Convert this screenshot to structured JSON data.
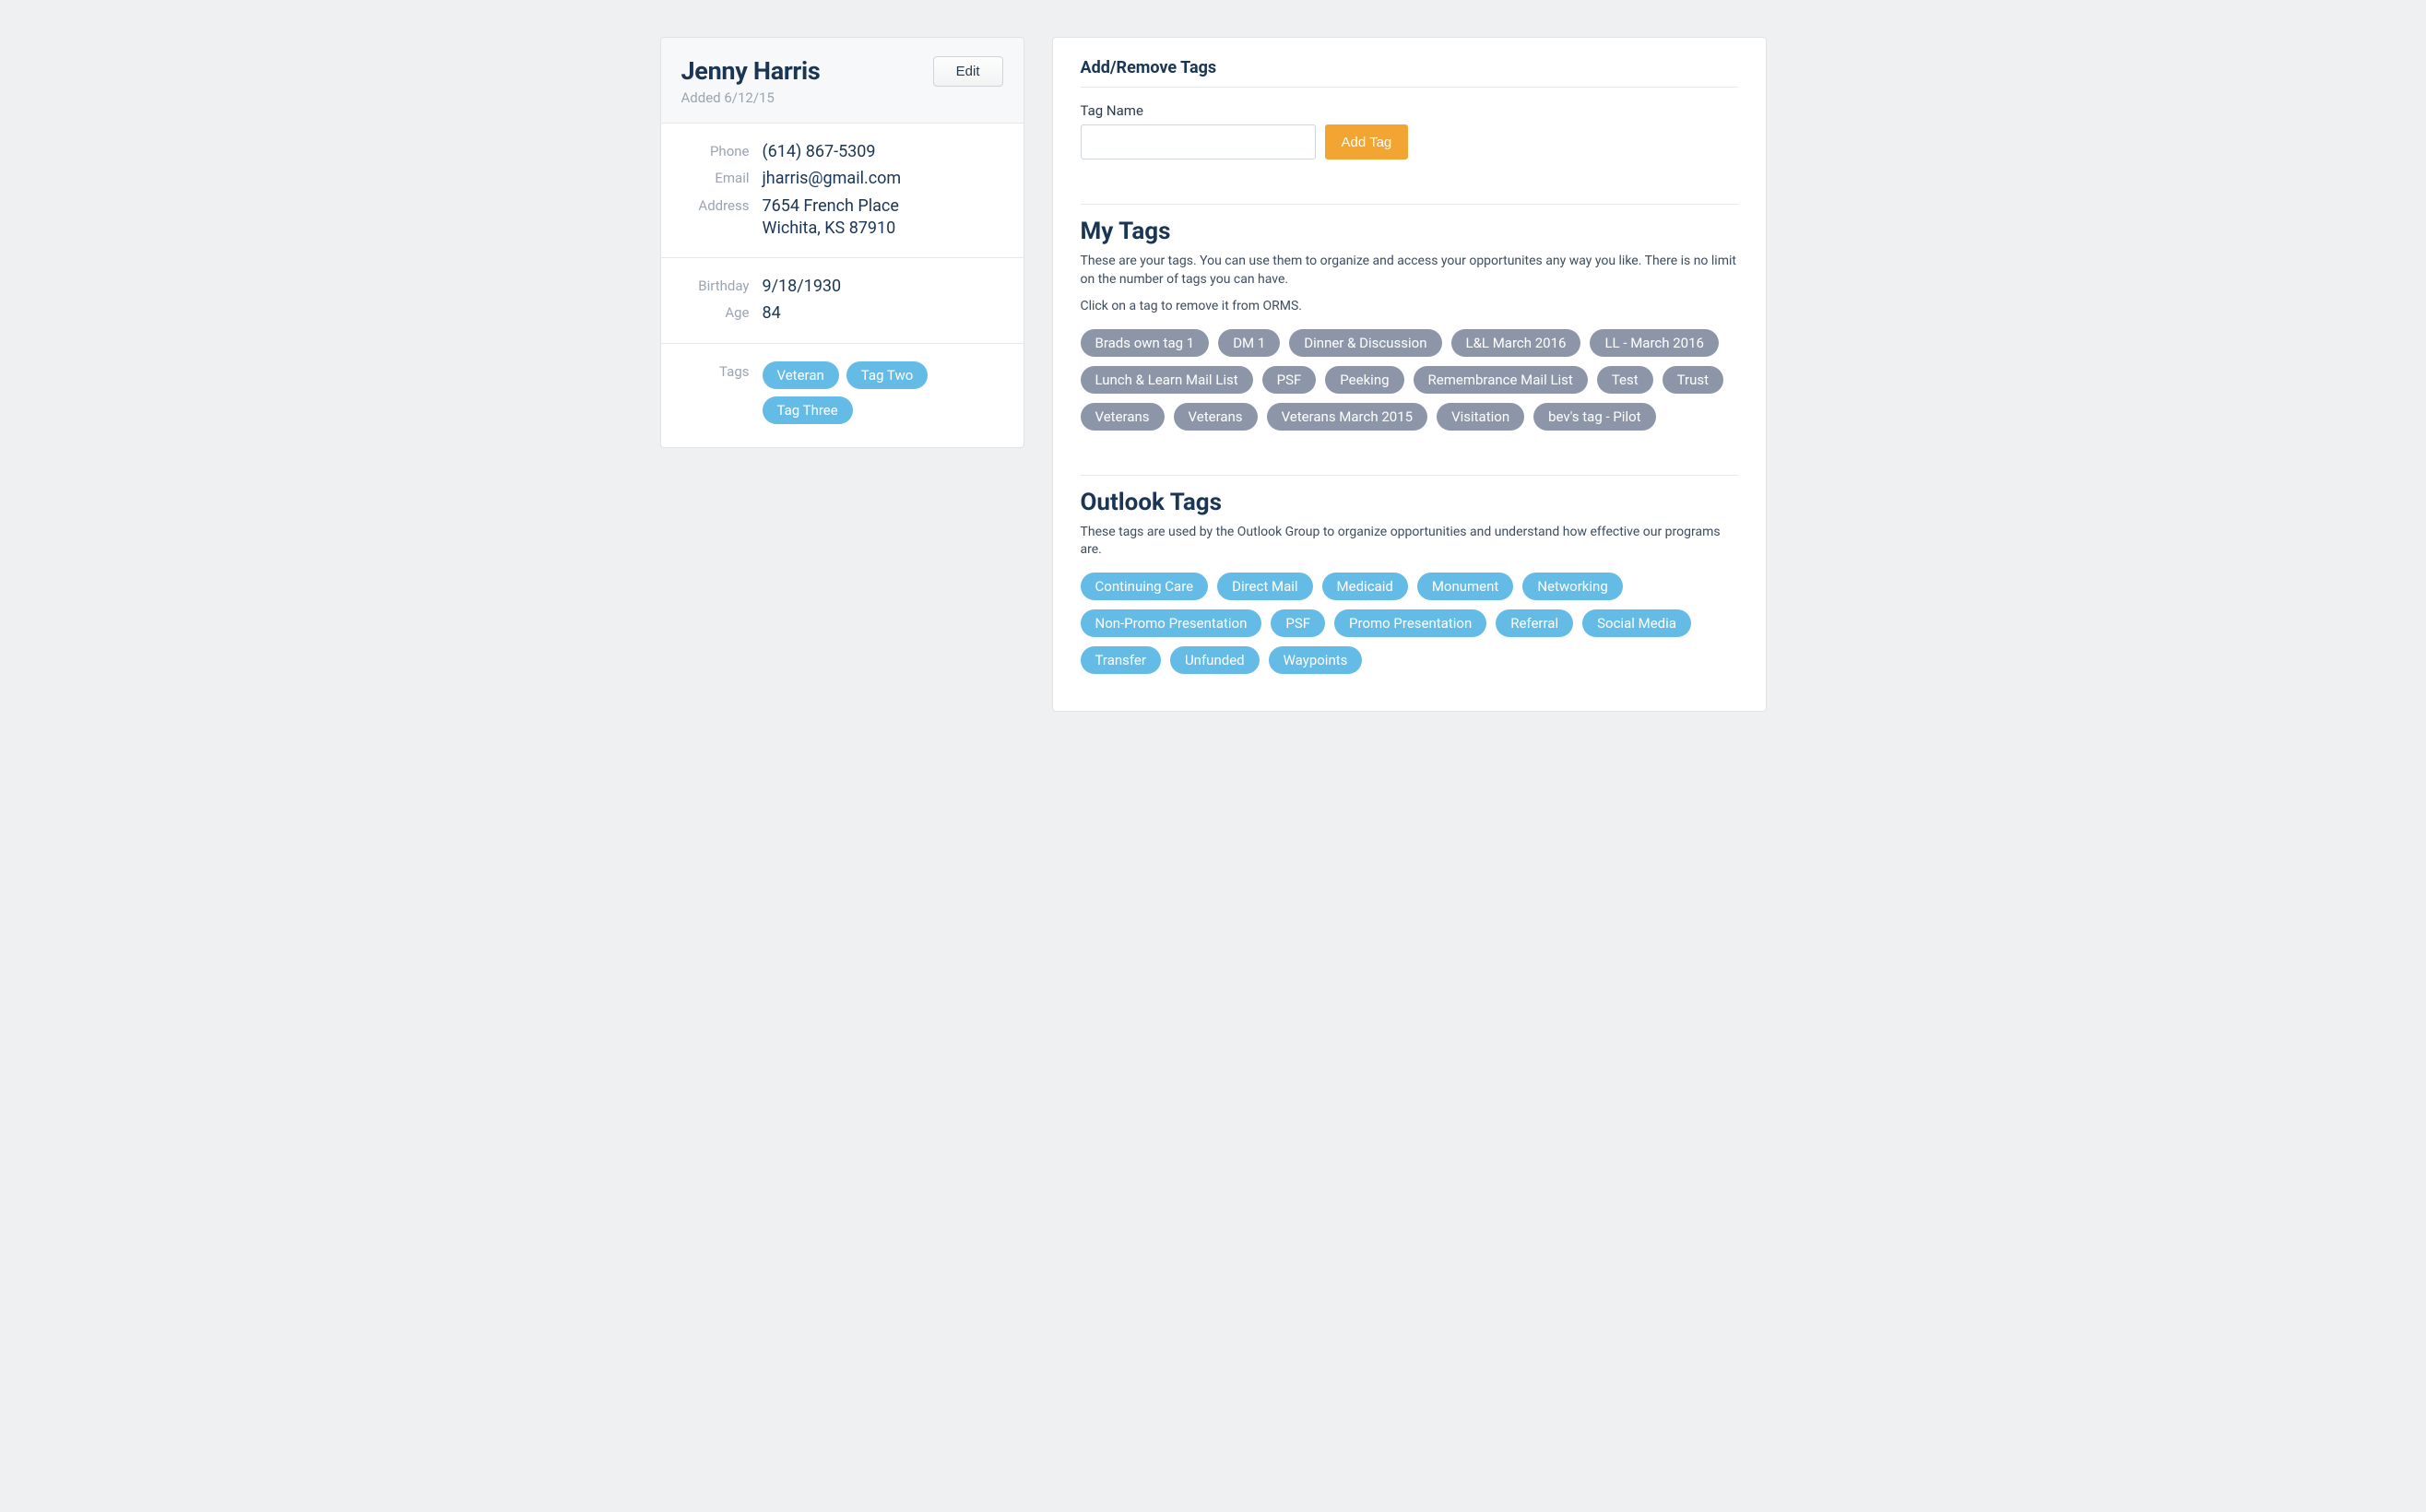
{
  "profile": {
    "name": "Jenny Harris",
    "added": "Added 6/12/15",
    "edit_label": "Edit",
    "fields": {
      "phone_label": "Phone",
      "phone_value": "(614) 867-5309",
      "email_label": "Email",
      "email_value": "jharris@gmail.com",
      "address_label": "Address",
      "address_line1": "7654 French Place",
      "address_line2": "Wichita, KS 87910",
      "birthday_label": "Birthday",
      "birthday_value": "9/18/1930",
      "age_label": "Age",
      "age_value": "84",
      "tags_label": "Tags"
    },
    "tags": [
      "Veteran",
      "Tag Two",
      "Tag Three"
    ]
  },
  "addRemove": {
    "title": "Add/Remove Tags",
    "field_label": "Tag Name",
    "input_value": "",
    "button_label": "Add Tag"
  },
  "myTags": {
    "title": "My Tags",
    "desc1": "These are your tags. You can use them to organize and access your opportunites any way you like. There is no limit on the number of tags you can have.",
    "desc2": "Click on a tag to remove it from ORMS.",
    "tags": [
      "Brads own tag 1",
      "DM 1",
      "Dinner & Discussion",
      "L&L March 2016",
      "LL - March 2016",
      "Lunch & Learn Mail List",
      "PSF",
      "Peeking",
      "Remembrance Mail List",
      "Test",
      "Trust",
      "Veterans",
      "Veterans",
      "Veterans March 2015",
      "Visitation",
      "bev's tag - Pilot"
    ]
  },
  "outlookTags": {
    "title": "Outlook Tags",
    "desc": "These tags are used by the Outlook Group to organize opportunities and understand how effective our programs are.",
    "tags": [
      "Continuing Care",
      "Direct Mail",
      "Medicaid",
      "Monument",
      "Networking",
      "Non-Promo Presentation",
      "PSF",
      "Promo Presentation",
      "Referral",
      "Social Media",
      "Transfer",
      "Unfunded",
      "Waypoints"
    ]
  }
}
